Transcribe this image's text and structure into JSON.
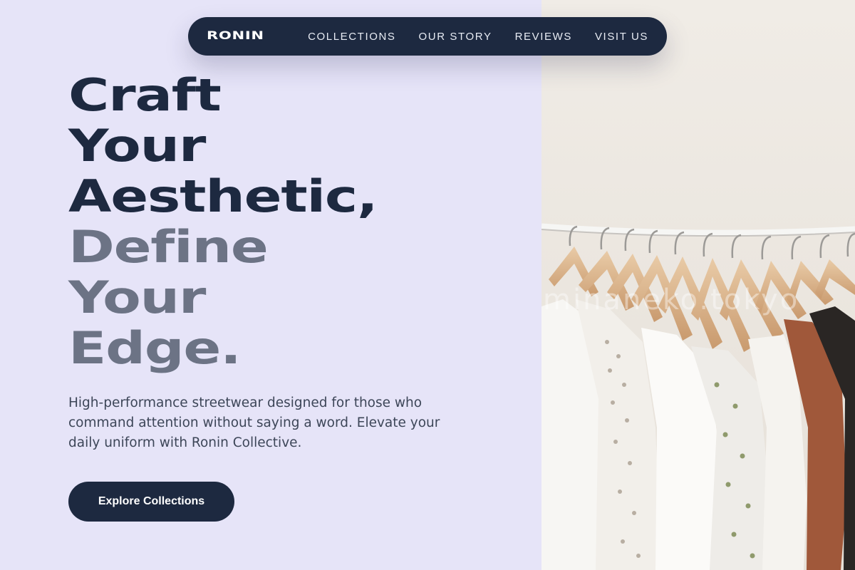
{
  "nav": {
    "logo": "RONIN",
    "links": [
      "COLLECTIONS",
      "OUR STORY",
      "REVIEWS",
      "VISIT US"
    ]
  },
  "hero": {
    "headline_lines": [
      "Craft",
      "Your",
      "Aesthetic,",
      "Define",
      "Your",
      "Edge."
    ],
    "subtext": "High-performance streetwear designed for those who command attention without saying a word. Elevate your daily uniform with Ronin Collective.",
    "cta_label": "Explore Collections"
  },
  "image": {
    "watermark": "minaneko.tokyo",
    "subject": "clothing-rack-photo"
  },
  "colors": {
    "page_bg": "#e6e4f8",
    "navy": "#1d2940",
    "headline_gray": "#6c7385",
    "body_text": "#3d4658",
    "photo_wall": "#ebe6e0"
  }
}
